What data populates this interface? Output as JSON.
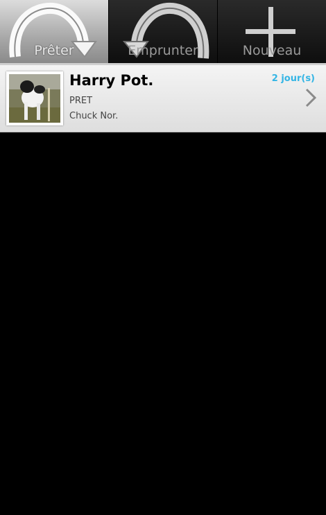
{
  "tabs": [
    {
      "label": "Prêter",
      "icon": "arrow-curved-right-icon",
      "selected": true
    },
    {
      "label": "Emprunter",
      "icon": "arrow-curved-left-icon",
      "selected": false
    },
    {
      "label": "Nouveau",
      "icon": "plus-icon",
      "selected": false
    }
  ],
  "list": {
    "items": [
      {
        "title": "Harry Pot.",
        "type": "PRET",
        "person": "Chuck Nor.",
        "duration": "2 jour(s)",
        "thumbnail_icon": "dog-photo-thumbnail",
        "chevron_icon": "chevron-right-icon"
      }
    ]
  },
  "colors": {
    "accent": "#33b5e5",
    "background": "#000000",
    "list_item_bg": "#ececec"
  }
}
